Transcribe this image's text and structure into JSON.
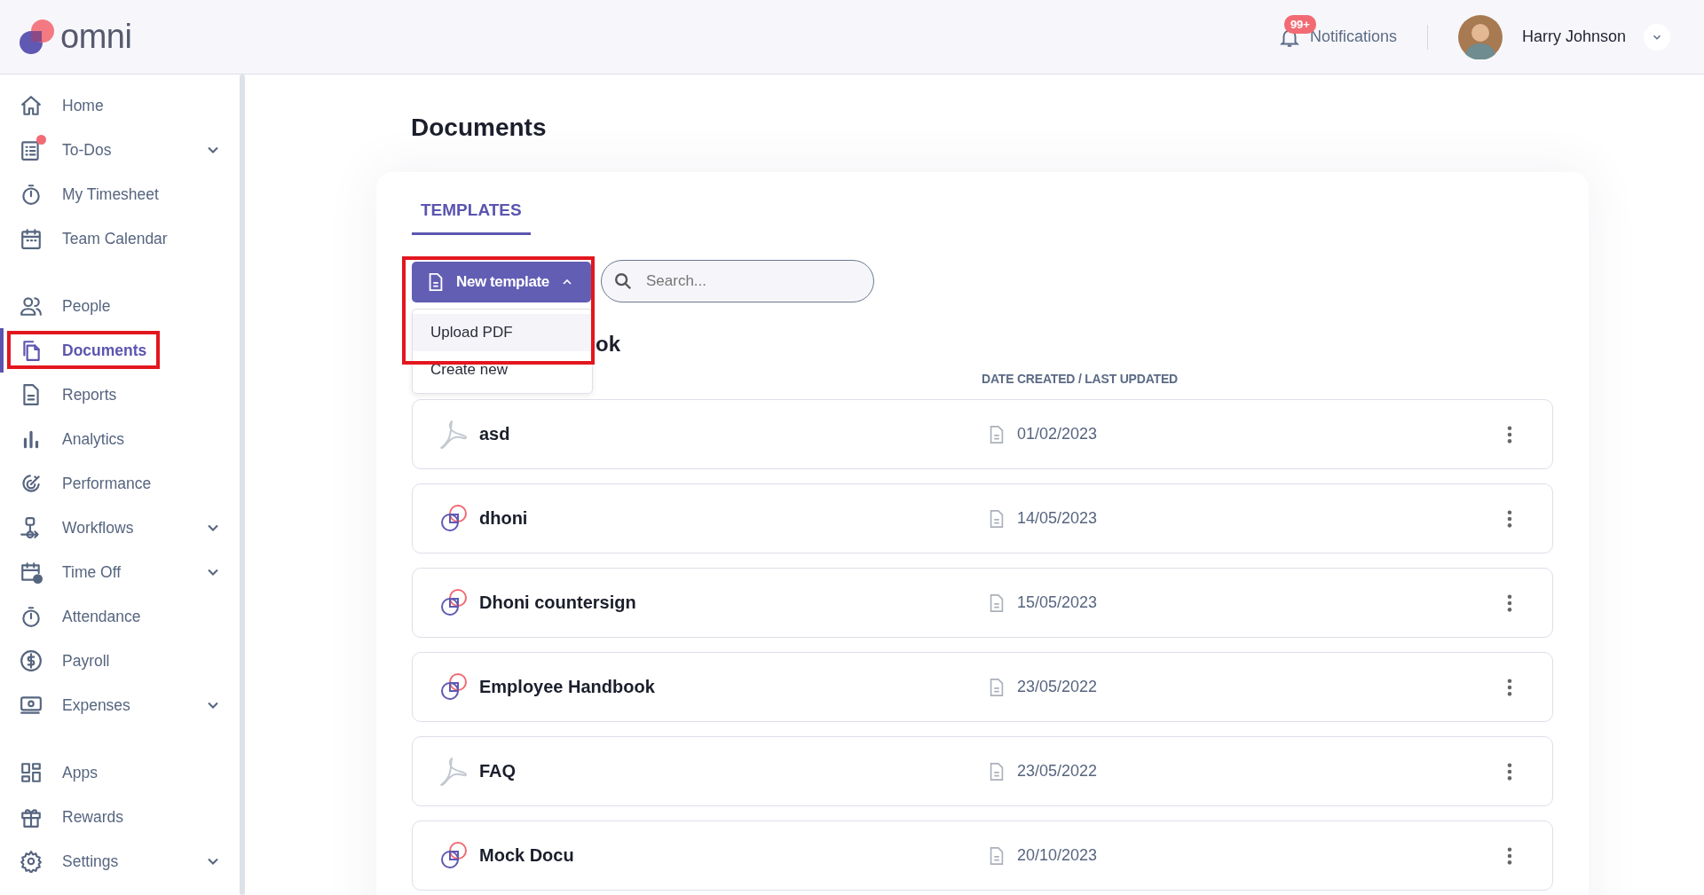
{
  "header": {
    "logo": "omni",
    "notifications": {
      "badge": "99+",
      "label": "Notifications"
    },
    "user": {
      "name": "Harry Johnson"
    }
  },
  "sidebar": {
    "groups": [
      [
        {
          "label": "Home",
          "selected": false,
          "expandable": false,
          "dot": false,
          "highlighted": false
        },
        {
          "label": "To-Dos",
          "selected": false,
          "expandable": true,
          "dot": true,
          "highlighted": false
        },
        {
          "label": "My Timesheet",
          "selected": false,
          "expandable": false,
          "dot": false,
          "highlighted": false
        },
        {
          "label": "Team Calendar",
          "selected": false,
          "expandable": false,
          "dot": false,
          "highlighted": false
        }
      ],
      [
        {
          "label": "People",
          "selected": false,
          "expandable": false,
          "dot": false,
          "highlighted": false
        },
        {
          "label": "Documents",
          "selected": true,
          "expandable": false,
          "dot": false,
          "highlighted": true
        },
        {
          "label": "Reports",
          "selected": false,
          "expandable": false,
          "dot": false,
          "highlighted": false
        },
        {
          "label": "Analytics",
          "selected": false,
          "expandable": false,
          "dot": false,
          "highlighted": false
        },
        {
          "label": "Performance",
          "selected": false,
          "expandable": false,
          "dot": false,
          "highlighted": false
        },
        {
          "label": "Workflows",
          "selected": false,
          "expandable": true,
          "dot": false,
          "highlighted": false
        },
        {
          "label": "Time Off",
          "selected": false,
          "expandable": true,
          "dot": false,
          "highlighted": false
        },
        {
          "label": "Attendance",
          "selected": false,
          "expandable": false,
          "dot": false,
          "highlighted": false
        },
        {
          "label": "Payroll",
          "selected": false,
          "expandable": false,
          "dot": false,
          "highlighted": false
        },
        {
          "label": "Expenses",
          "selected": false,
          "expandable": true,
          "dot": false,
          "highlighted": false
        }
      ],
      [
        {
          "label": "Apps",
          "selected": false,
          "expandable": false,
          "dot": false,
          "highlighted": false
        },
        {
          "label": "Rewards",
          "selected": false,
          "expandable": false,
          "dot": false,
          "highlighted": false
        },
        {
          "label": "Settings",
          "selected": false,
          "expandable": true,
          "dot": false,
          "highlighted": false
        }
      ]
    ]
  },
  "main": {
    "title": "Documents",
    "tabs": [
      {
        "label": "TEMPLATES",
        "selected": true
      }
    ],
    "new_template_button": {
      "label": "New template",
      "expanded": true,
      "highlighted": true
    },
    "new_template_menu": [
      {
        "label": "Upload PDF",
        "selected": true
      },
      {
        "label": "Create new",
        "selected": false
      }
    ],
    "search": {
      "placeholder": "Search..."
    },
    "section_heading": "ok",
    "table": {
      "date_column_header": "DATE CREATED / LAST UPDATED",
      "rows": [
        {
          "name": "asd",
          "kind": "pdf",
          "date": "01/02/2023"
        },
        {
          "name": "dhoni",
          "kind": "omni",
          "date": "14/05/2023"
        },
        {
          "name": "Dhoni countersign",
          "kind": "omni",
          "date": "15/05/2023"
        },
        {
          "name": "Employee Handbook",
          "kind": "omni",
          "date": "23/05/2022"
        },
        {
          "name": "FAQ",
          "kind": "pdf",
          "date": "23/05/2022"
        },
        {
          "name": "Mock Docu",
          "kind": "omni",
          "date": "20/10/2023"
        }
      ]
    }
  }
}
